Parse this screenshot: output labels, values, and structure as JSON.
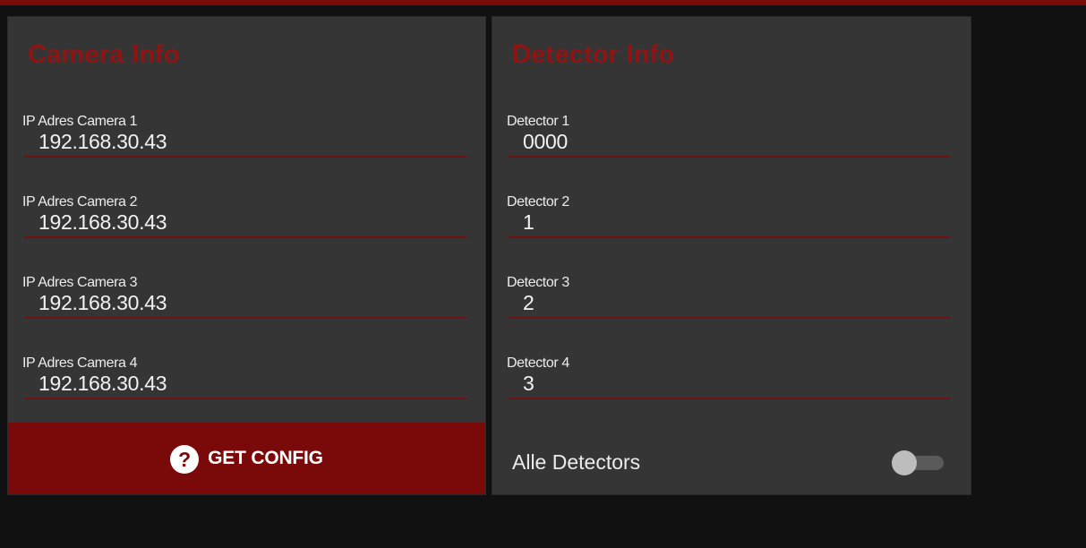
{
  "camera_panel": {
    "title": "Camera Info",
    "fields": [
      {
        "label": "IP Adres Camera 1",
        "value": "192.168.30.43"
      },
      {
        "label": "IP Adres Camera 2",
        "value": "192.168.30.43"
      },
      {
        "label": "IP Adres Camera 3",
        "value": "192.168.30.43"
      },
      {
        "label": "IP Adres Camera 4",
        "value": "192.168.30.43"
      }
    ],
    "get_config_label": "GET CONFIG",
    "help_icon_glyph": "?"
  },
  "detector_panel": {
    "title": "Detector Info",
    "fields": [
      {
        "label": "Detector 1",
        "value": "0000"
      },
      {
        "label": "Detector 2",
        "value": "1"
      },
      {
        "label": "Detector 3",
        "value": "2"
      },
      {
        "label": "Detector 4",
        "value": "3"
      }
    ],
    "all_detectors_label": "Alle Detectors",
    "all_detectors_enabled": false
  },
  "colors": {
    "accent_red": "#8f1414",
    "button_red": "#7a0909",
    "panel_bg": "#353535",
    "page_bg": "#111111"
  },
  "icons": {
    "help": "help-circle-icon",
    "toggle": "toggle-switch"
  }
}
